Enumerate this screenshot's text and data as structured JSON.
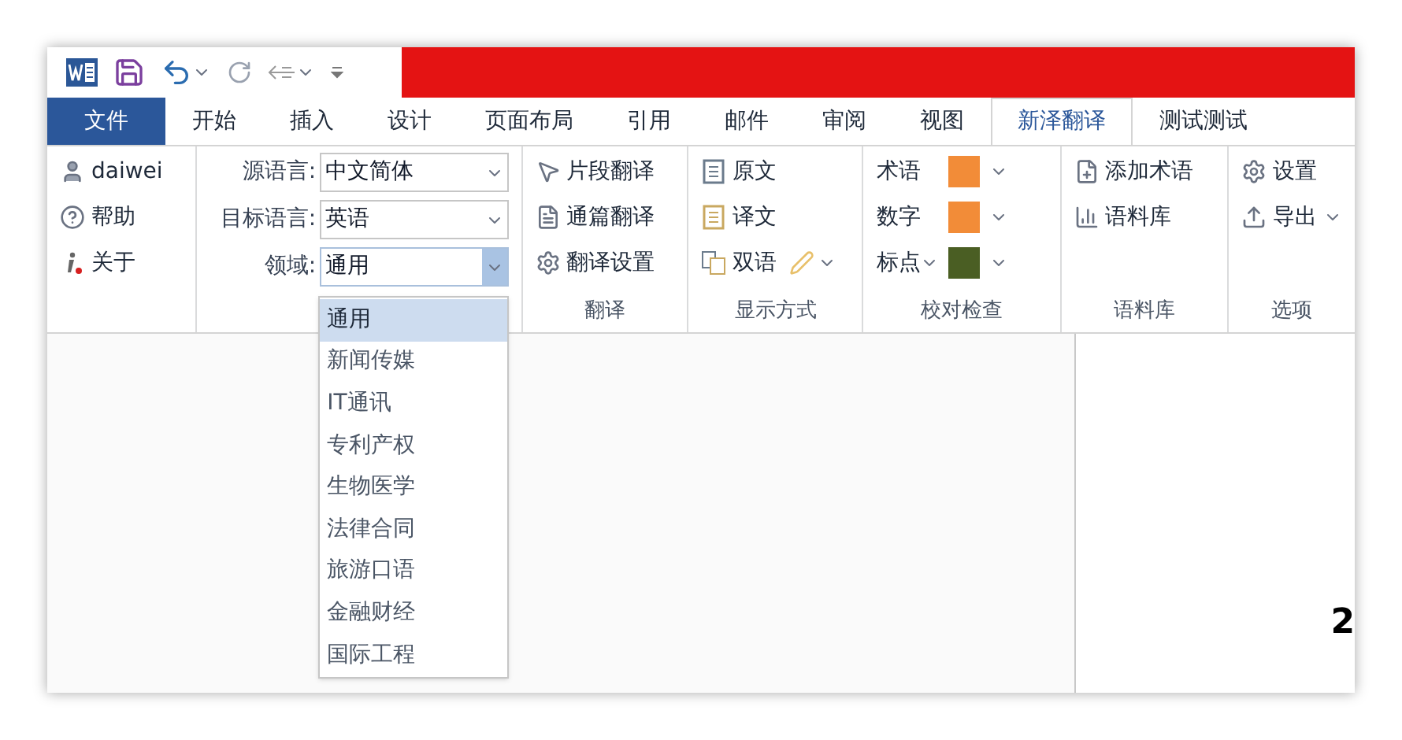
{
  "tabs": [
    {
      "label": "文件",
      "kind": "file",
      "selected": false
    },
    {
      "label": "开始",
      "kind": "tab",
      "selected": false
    },
    {
      "label": "插入",
      "kind": "tab",
      "selected": false
    },
    {
      "label": "设计",
      "kind": "tab",
      "selected": false
    },
    {
      "label": "页面布局",
      "kind": "tab",
      "selected": false
    },
    {
      "label": "引用",
      "kind": "tab",
      "selected": false
    },
    {
      "label": "邮件",
      "kind": "tab",
      "selected": false
    },
    {
      "label": "审阅",
      "kind": "tab",
      "selected": false
    },
    {
      "label": "视图",
      "kind": "tab",
      "selected": false
    },
    {
      "label": "新泽翻译",
      "kind": "tab",
      "selected": true
    },
    {
      "label": "测试测试",
      "kind": "tab",
      "selected": false
    }
  ],
  "user_group": {
    "items": [
      {
        "kind": "user",
        "label": "daiwei"
      },
      {
        "kind": "help",
        "label": "帮助"
      },
      {
        "kind": "about",
        "label": "关于"
      }
    ]
  },
  "language_group": {
    "fields": [
      {
        "label": "源语言:",
        "value": "中文简体",
        "open": false
      },
      {
        "label": "目标语言:",
        "value": "英语",
        "open": false
      },
      {
        "label": "领域:",
        "value": "通用",
        "open": true
      }
    ],
    "dropdown_options": [
      {
        "label": "通用",
        "selected": true
      },
      {
        "label": "新闻传媒",
        "selected": false
      },
      {
        "label": "IT通讯",
        "selected": false
      },
      {
        "label": "专利产权",
        "selected": false
      },
      {
        "label": "生物医学",
        "selected": false
      },
      {
        "label": "法律合同",
        "selected": false
      },
      {
        "label": "旅游口语",
        "selected": false
      },
      {
        "label": "金融财经",
        "selected": false
      },
      {
        "label": "国际工程",
        "selected": false
      }
    ]
  },
  "translate_group": {
    "label": "翻译",
    "items": [
      {
        "kind": "segment",
        "label": "片段翻译"
      },
      {
        "kind": "document",
        "label": "通篇翻译"
      },
      {
        "kind": "settings",
        "label": "翻译设置"
      }
    ]
  },
  "display_group": {
    "label": "显示方式",
    "items": [
      {
        "kind": "source",
        "label": "原文"
      },
      {
        "kind": "target",
        "label": "译文"
      },
      {
        "kind": "bilingual",
        "label": "双语"
      }
    ]
  },
  "proof_group": {
    "label": "校对检查",
    "items": [
      {
        "label": "术语",
        "color": "#f28c38",
        "has_menu": false
      },
      {
        "label": "数字",
        "color": "#f28c38",
        "has_menu": false
      },
      {
        "label": "标点",
        "color": "#4a5e23",
        "has_menu": true
      }
    ]
  },
  "corpus_group": {
    "label": "语料库",
    "items": [
      {
        "kind": "add",
        "label": "添加术语"
      },
      {
        "kind": "corpus",
        "label": "语料库"
      }
    ]
  },
  "options_group": {
    "label": "选项",
    "items": [
      {
        "kind": "settings",
        "label": "设置",
        "has_menu": false
      },
      {
        "kind": "export",
        "label": "导出",
        "has_menu": true
      }
    ]
  },
  "document": {
    "text": "2"
  }
}
